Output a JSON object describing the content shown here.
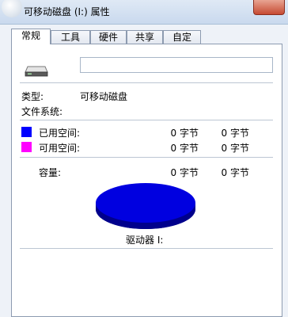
{
  "window": {
    "title": "可移动磁盘 (I:) 属性"
  },
  "tabs": [
    "常规",
    "工具",
    "硬件",
    "共享",
    "自定义"
  ],
  "general": {
    "name_value": "",
    "type_label": "类型:",
    "type_value": "可移动磁盘",
    "fs_label": "文件系统:",
    "fs_value": "",
    "used_label": "已用空间:",
    "used_bytes": "0 字节",
    "used_size": "0 字节",
    "free_label": "可用空间:",
    "free_bytes": "0 字节",
    "free_size": "0 字节",
    "capacity_label": "容量:",
    "capacity_bytes": "0 字节",
    "capacity_size": "0 字节",
    "drive_label": "驱动器 I:"
  },
  "colors": {
    "used": "#0000ff",
    "free": "#ff00ff",
    "pie": "#0000e0"
  },
  "icons": {
    "drive": "removable-drive-icon",
    "close": "close-icon"
  }
}
